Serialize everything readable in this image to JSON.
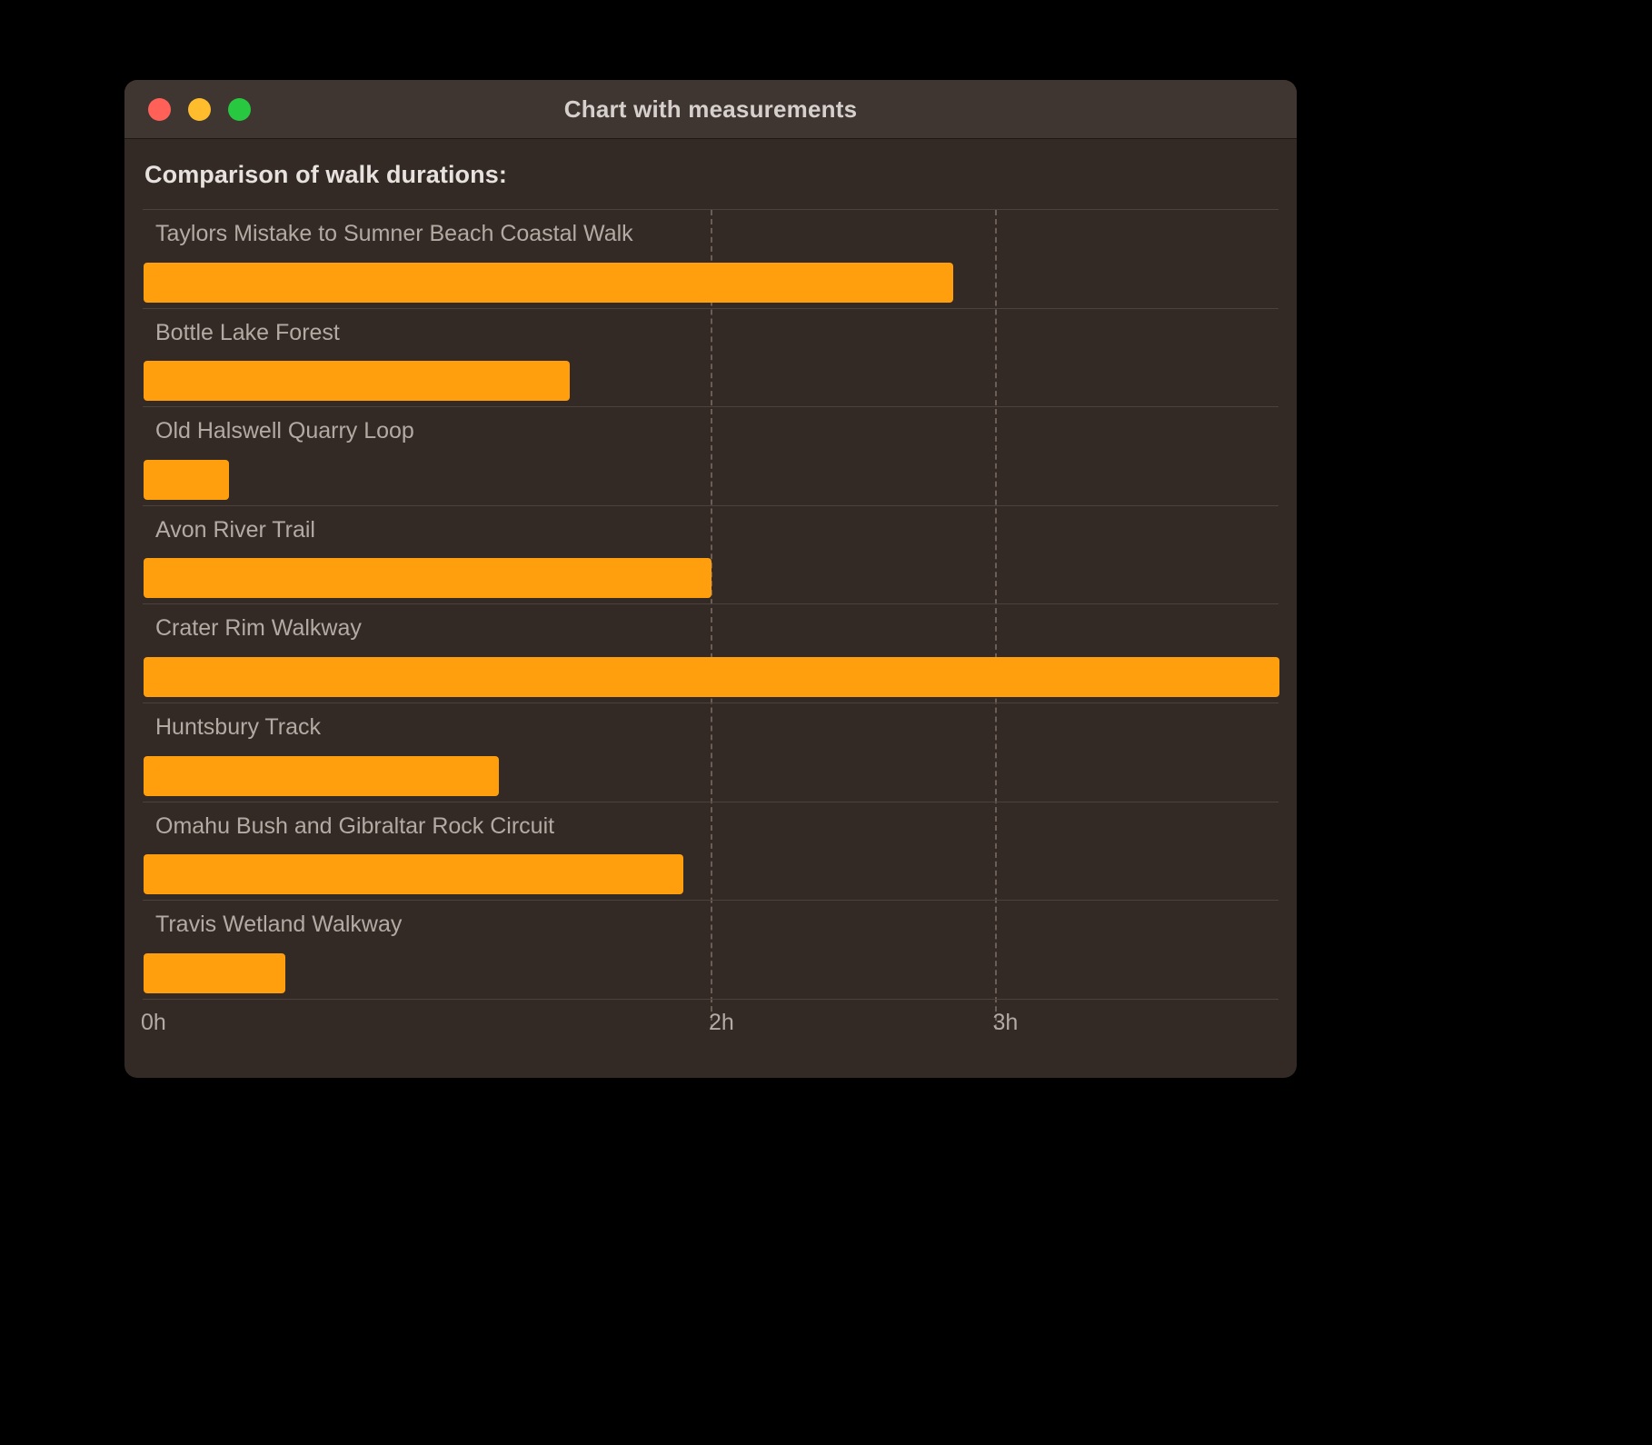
{
  "window": {
    "title": "Chart with measurements",
    "traffic_lights": [
      {
        "name": "close",
        "color": "#FF6159"
      },
      {
        "name": "minimize",
        "color": "#FFBD2E"
      },
      {
        "name": "maximize",
        "color": "#28C840"
      }
    ],
    "colors": {
      "background": "#332A26",
      "titlebar": "#3F3632",
      "accent": "#FF9F0E",
      "gridline": "#6B5E57",
      "rowline": "#4C423D",
      "label_text": "#B4AAA4",
      "heading_text": "#E7E2DE"
    }
  },
  "heading": "Comparison of walk durations:",
  "chart_data": {
    "type": "bar",
    "orientation": "horizontal",
    "title": "Comparison of walk durations:",
    "xlabel": "",
    "ylabel": "",
    "unit": "hours",
    "xlim": [
      0,
      4.0
    ],
    "grid": true,
    "legend": null,
    "tick_labels": [
      "0h",
      "2h",
      "3h"
    ],
    "tick_values": [
      0,
      2,
      3
    ],
    "bar_color": "#FF9F0E",
    "categories": [
      "Taylors Mistake to Sumner Beach Coastal Walk",
      "Bottle Lake Forest",
      "Old Halswell Quarry Loop",
      "Avon River Trail",
      "Crater Rim Walkway",
      "Huntsbury Track",
      "Omahu Bush and Gibraltar Rock Circuit",
      "Travis Wetland Walkway"
    ],
    "values": [
      2.85,
      1.5,
      0.3,
      2.0,
      4.0,
      1.25,
      1.9,
      0.5
    ]
  }
}
